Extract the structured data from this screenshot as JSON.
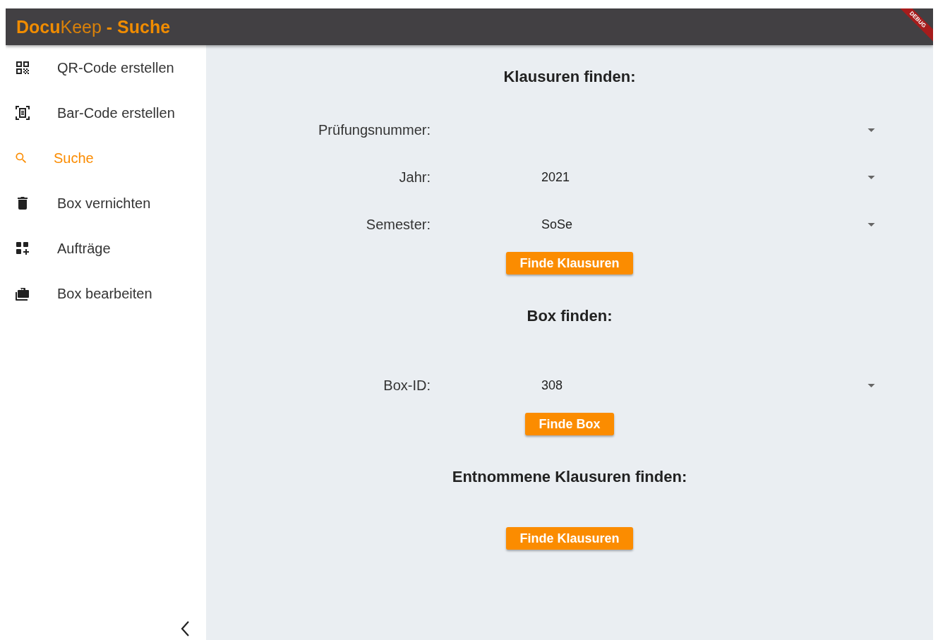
{
  "app_bar": {
    "title_parts": [
      {
        "text": "Docu",
        "kind": "bold"
      },
      {
        "text": "Keep",
        "kind": "light"
      },
      {
        "text": " - Suche",
        "kind": "bold"
      }
    ],
    "debug_banner": "DEBUG"
  },
  "sidebar": {
    "items": [
      {
        "label": "QR-Code erstellen",
        "selected": false
      },
      {
        "label": "Bar-Code erstellen",
        "selected": false
      },
      {
        "label": "Suche",
        "selected": true
      },
      {
        "label": "Box vernichten",
        "selected": false
      },
      {
        "label": "Aufträge",
        "selected": false
      },
      {
        "label": "Box bearbeiten",
        "selected": false
      }
    ]
  },
  "sections": [
    {
      "title": "Klausuren finden:",
      "fields": [
        {
          "label": "Prüfungsnummer:"
        },
        {
          "label": "Jahr:",
          "value": "2021"
        },
        {
          "label": "Semester:",
          "value": "SoSe"
        }
      ],
      "button": "Finde Klausuren"
    },
    {
      "title": "Box finden:",
      "fields": [
        {
          "label": "Box-ID:",
          "value": "308"
        }
      ],
      "button": "Finde Box"
    },
    {
      "title": "Entnommene Klausuren finden:",
      "button": "Finde Klausuren"
    }
  ]
}
